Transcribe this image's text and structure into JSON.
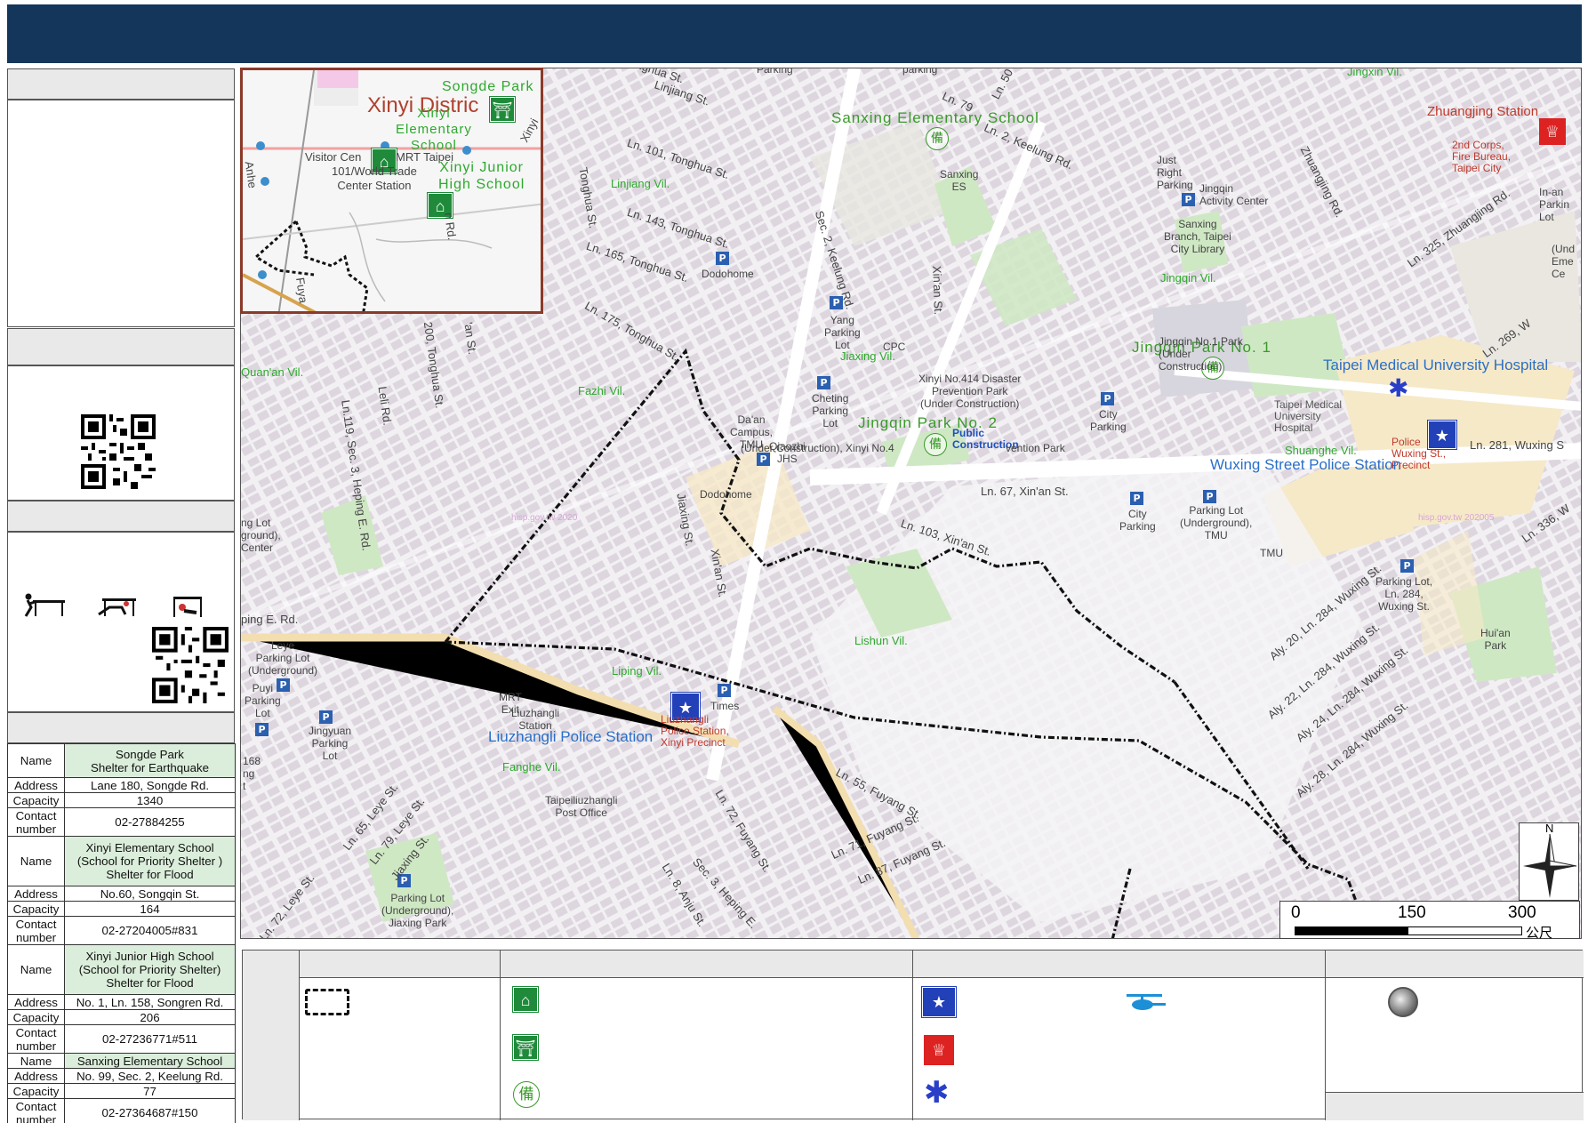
{
  "header": {
    "title": ""
  },
  "shelters": [
    {
      "name_label": "Name",
      "name": "Songde Park\nShelter for Earthquake",
      "address_label": "Address",
      "address": "Lane 180, Songde Rd.",
      "capacity_label": "Capacity",
      "capacity": "1340",
      "contact_label": "Contact number",
      "contact": "02-27884255"
    },
    {
      "name_label": "Name",
      "name": "Xinyi Elementary School\n(School for Priority Shelter )\nShelter for Flood",
      "address_label": "Address",
      "address": "No.60, Songqin St.",
      "capacity_label": "Capacity",
      "capacity": "164",
      "contact_label": "Contact number",
      "contact": "02-27204005#831"
    },
    {
      "name_label": "Name",
      "name": "Xinyi Junior High School\n(School for Priority Shelter)\nShelter for Flood",
      "address_label": "Address",
      "address": "No. 1, Ln. 158, Songren Rd.",
      "capacity_label": "Capacity",
      "capacity": "206",
      "contact_label": "Contact number",
      "contact": "02-27236771#511"
    },
    {
      "name_label": "Name",
      "name": "Sanxing Elementary School",
      "address_label": "Address",
      "address": "No. 99, Sec. 2, Keelung Rd.",
      "capacity_label": "Capacity",
      "capacity": "77",
      "contact_label": "Contact number",
      "contact": "02-27364687#150"
    }
  ],
  "map": {
    "facility_labels": {
      "sanxing_es": "Sanxing Elementary School",
      "jingqin_park_1": "Jingqin Park No. 1",
      "jingqin_park_2": "Jingqin Park No. 2",
      "tmu_hospital": "Taipei Medical University Hospital",
      "wuxing_police": "Wuxing Street Police Station",
      "liuzhangli_police": "Liuzhangli Police Station",
      "zhuangjing_station": "Zhuangjing Station"
    },
    "small_labels": {
      "tonghua": "Tonghua St.",
      "linjiang": "Linjiang St.",
      "ln101": "Ln. 101, Tonghua St.",
      "linjiang_vil": "Linjiang Vil.",
      "ln143": "Ln. 143, Tonghua St.",
      "ln165": "Ln. 165, Tonghua St.",
      "ln175": "Ln. 175, Tonghua St.",
      "dodohome": "Dodohome",
      "yang_parking": "Yang\nParking\nLot",
      "cpc": "CPC",
      "fazhi_vil": "Fazhi Vil.",
      "cheting": "Cheting\nParking\nLot",
      "daan_campus": "Da'an\nCampus,\nTMU",
      "qiaozhi": "Qiaozhi\nJHS",
      "dodohome2": "Dodohome",
      "jiaxing_vil": "Jiaxing Vil.",
      "keelung": "Sec. 2, Keelung Rd.",
      "sanxing_es_small": "Sanxing\nES",
      "just_right": "Just\nRight\nParking",
      "jingqin_activity": "Jingqin\nActivity Center",
      "sanxing_library": "Sanxing\nBranch, Taipei\nCity Library",
      "jingqin_vil": "Jingqin Vil.",
      "xinan_st": "Xin'an St.",
      "ln79": "Ln. 79",
      "ln2_keelung": "Ln. 2, Keelung Rd.",
      "ln50": "Ln. 50",
      "zhuangjing_rd": "Zhuangjing Rd.",
      "ln325": "Ln. 325, Zhuangjing Rd.",
      "in_an": "In-an\nParkin\nLot",
      "xinyi414": "Xinyi No.414 Disaster\nPrevention Park\n(Under Construction)",
      "public_construction": "Public\nConstruction",
      "under_construction": "(Under Construction), Xinyi No.4",
      "vention_park": "vention Park",
      "city_parking1": "City\nParking",
      "jingqin_1_park": "Jingqin No.1 Park\n(Under\nConstruction)",
      "construction": "Construction",
      "ln67": "Ln. 67, Xin'an St.",
      "city_parking2": "City\nParking",
      "parking_lot_tmu": "Parking Lot\n(Underground),\nTMU",
      "tmu": "TMU",
      "shuanghe_vil": "Shuanghe Vil.",
      "tmu_hospital_small": "Taipei Medical\nUniversity\nHospital",
      "police_wuxing": "Police\nWuxing St.,\nPrecinct",
      "ln269": "Ln. 269, W",
      "ln281": "Ln. 281, Wuxing S",
      "ln336": "Ln. 336, W",
      "parking_284": "Parking Lot,\nLn. 284,\nWuxing St.",
      "huian_park": "Hui'an\nPark",
      "lishun_vil": "Lishun Vil.",
      "jiaxing_st": "Jiaxing St.",
      "xinan_st2": "Xin'an St.",
      "ln103": "Ln. 103, Xin'an St.",
      "aly20": "Aly. 20, Ln. 284, Wuxing St.",
      "aly22": "Aly. 22, Ln. 284, Wuxing St.",
      "aly24": "Aly. 24, Ln. 284, Wuxing St.",
      "aly28": "Aly. 28, Ln. 284, Wuxing St.",
      "liping_vil": "Liping Vil.",
      "times": "Times",
      "mrt_exit": "MRT\nExit",
      "liuzhangli_station": "Liuzhangli\nStation",
      "police_liuzhangli": "Liuzhangli\nPolice Station,\nXinyi Precinct",
      "fanghe_vil": "Fanghe Vil.",
      "post_office": "Taipeiliuzhangli\nPost Office",
      "ln55": "Ln. 55, Fuyang St.",
      "ln71": "Ln. 71, Fuyang St.",
      "ln87": "Ln. 87, Fuyang St.",
      "ln72_fuyang": "Ln. 72, Fuyang St.",
      "ln8_anju": "Ln. 8, Anju St.",
      "heping_e": "Sec. 3, Heping E.",
      "leye": "Leye\nParking Lot\n(Underground)",
      "puyi": "Puyi\nParking\nLot",
      "jingyuan": "Jingyuan\nParking\nLot",
      "ln65": "Ln. 65, Leye St.",
      "ln79_leye": "Ln. 79, Leye St.",
      "ln72_leye": "Ln. 72, Leye St.",
      "jiaxing_st3": "Jiaxing St.",
      "parking_jiaxing": "Parking Lot\n(Underground),\nJiaxing Park",
      "ln119": "Ln.119, Sec. 3, Heping E. Rd.",
      "leli": "Leli Rd.",
      "ln200": "200, Tonghua St.",
      "an_st": "'an St.",
      "quanan_vil": "Quan'an Vil.",
      "ng_lot": "ng Lot\nground),\nCenter",
      "ping_e": "ping E. Rd.",
      "n168": "168\nng\nt",
      "parking_top": "Parking",
      "parking_top2": "parking",
      "jingxin_vil": "Jingxin Vil.",
      "tonghua_top": "Tonghua St.",
      "und_eme": "(Und\nEme\nCe",
      "second_corps": "2nd Corps,\nFire Bureau,\nTaipei City",
      "taipei_small": "Taipe",
      "fire_be": "Fire Be",
      "ct_mu": "ct,\nMU",
      "wm1": "hisp.gov.tw 2020",
      "wm2": "hisp.gov.tw 202005",
      "underground_small": "(Undergrou"
    },
    "inset_labels": {
      "district": "Xinyi Distric",
      "songde_park": "Songde Park",
      "xinyi_es": "Xinyi\nElementary\nSchool",
      "xinyi_jhs": "Xinyi Junior\nHigh School",
      "visitor": "Visitor Cen",
      "mrt_taipei": "MRT Taipei",
      "world_trade": "101/World Trade\nCenter Station",
      "anhe": "Anhe",
      "fuya": "Fuya",
      "n_rd": "n Rd.",
      "xinyi_r": "Xinyi"
    }
  },
  "compass": {
    "north": "N"
  },
  "scale": {
    "ticks": [
      "0",
      "150",
      "300"
    ],
    "unit": "公尺"
  },
  "legend": {
    "col0_header": "",
    "col1_header": "",
    "col2_header": "",
    "col3_header": "",
    "col4_header": "",
    "bei_glyph": "備"
  },
  "colors": {
    "header": "#14365a",
    "shelter": "#1f8b3a",
    "police": "#2240b8",
    "fire": "#d22222",
    "park": "#cfe8c4",
    "road_yellow": "#f5e9b8",
    "boundary": "#111111",
    "highlight_cell": "#dbeedb"
  },
  "icons": [
    "shelter-icon",
    "earthquake-shelter-icon",
    "bei-reserve-icon",
    "police-icon",
    "fire-station-icon",
    "medical-star-icon",
    "helicopter-icon",
    "meeting-point-icon",
    "parking-icon",
    "qr-code",
    "drill-figure-icon",
    "compass-rose"
  ]
}
